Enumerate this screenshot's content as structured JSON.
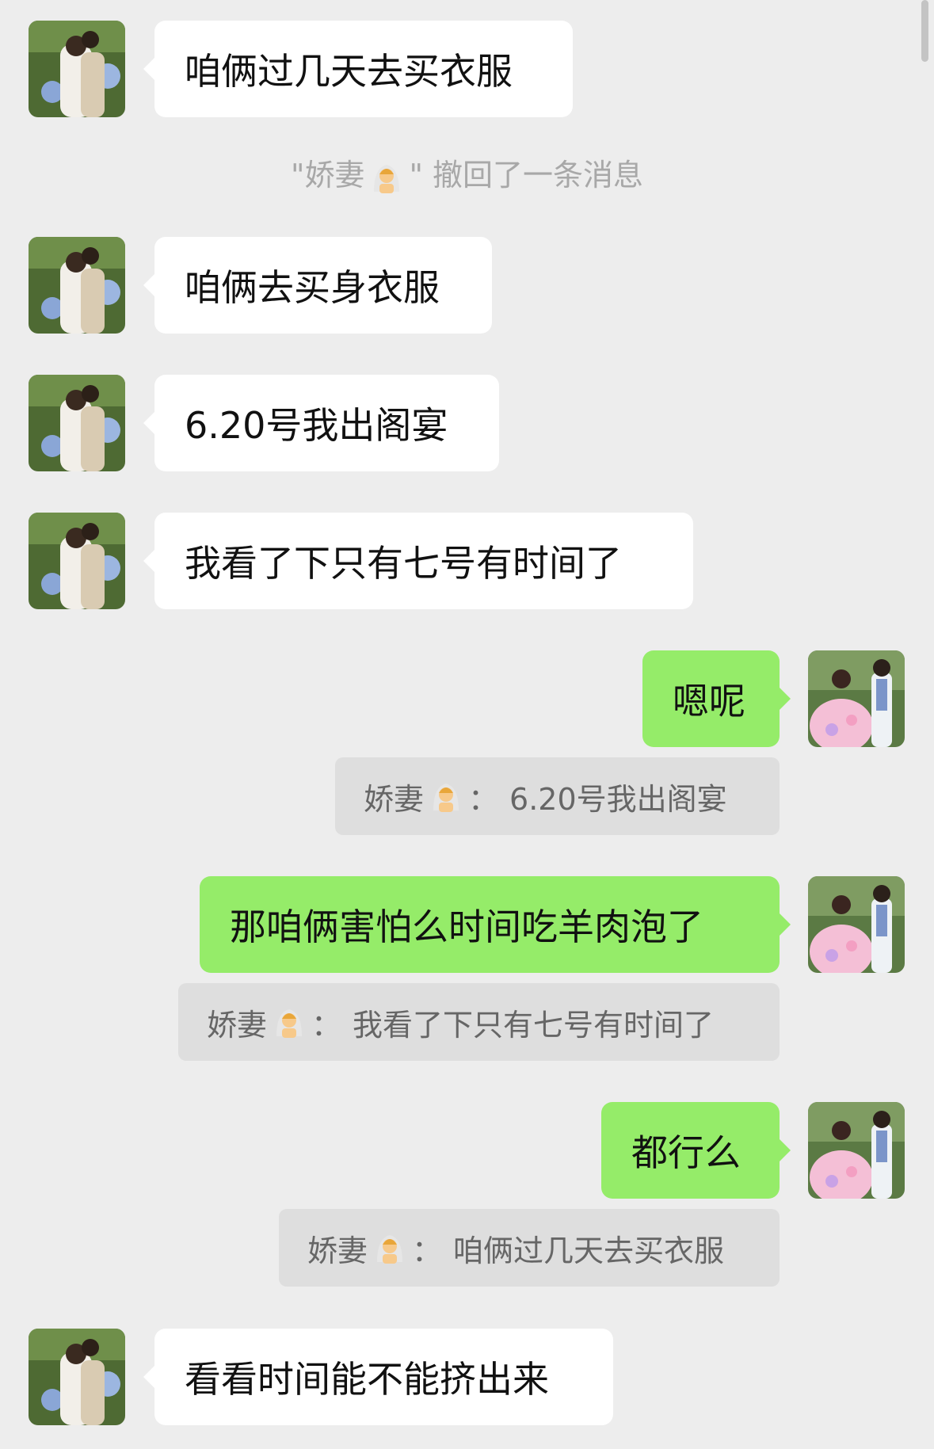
{
  "messages": {
    "m1": "咱俩过几天去买衣服",
    "recall_prefix": "\"娇妻",
    "recall_suffix": "\" 撤回了一条消息",
    "m2": "咱俩去买身衣服",
    "m3": "6.20号我出阁宴",
    "m4": "我看了下只有七号有时间了",
    "r1": "嗯呢",
    "q1_sender": "娇妻",
    "q1_sep": "：",
    "q1_text": "6.20号我出阁宴",
    "r2": "那咱俩害怕么时间吃羊肉泡了",
    "q2_sender": "娇妻",
    "q2_sep": "：",
    "q2_text": "我看了下只有七号有时间了",
    "r3": "都行么",
    "q3_sender": "娇妻",
    "q3_sep": "：",
    "q3_text": "咱俩过几天去买衣服",
    "m5": "看看时间能不能挤出来"
  },
  "icons": {
    "sender_emoji": "bride-with-veil-emoji",
    "left_avatar": "couple-wedding-photo-avatar",
    "right_avatar": "couple-wedding-photo-avatar-pink-dress"
  },
  "colors": {
    "background": "#ededed",
    "left_bubble": "#ffffff",
    "right_bubble": "#95ec69",
    "quote_bg": "#dedede"
  }
}
